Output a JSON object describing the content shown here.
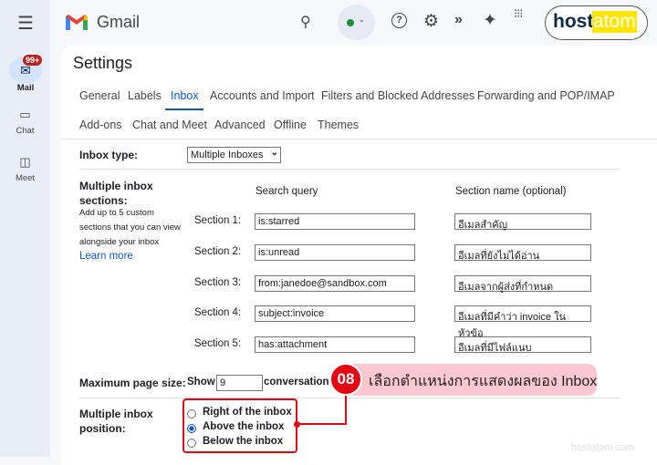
{
  "header": {
    "app_name": "Gmail",
    "brand": "host",
    "brand_highlight": "atom"
  },
  "rail": {
    "items": [
      {
        "label": "Mail",
        "badge": "99+"
      },
      {
        "label": "Chat"
      },
      {
        "label": "Meet"
      }
    ]
  },
  "settings": {
    "title": "Settings",
    "tabs_row1": [
      "General",
      "Labels",
      "Inbox",
      "Accounts and Import",
      "Filters and Blocked Addresses",
      "Forwarding and POP/IMAP"
    ],
    "tabs_row2": [
      "Add-ons",
      "Chat and Meet",
      "Advanced",
      "Offline",
      "Themes"
    ],
    "active_tab": "Inbox",
    "inbox_type": {
      "label": "Inbox type:",
      "value": "Multiple Inboxes"
    },
    "sections": {
      "title": "Multiple inbox sections:",
      "desc": [
        "Add up to 5 custom",
        "sections that you can view",
        "alongside your inbox"
      ],
      "learn_more": "Learn more",
      "col_query": "Search query",
      "col_name": "Section name (optional)",
      "rows": [
        {
          "label": "Section 1:",
          "query": "is:starred",
          "name": "อีเมลสำคัญ"
        },
        {
          "label": "Section 2:",
          "query": "is:unread",
          "name": "อีเมลที่ยังไม่ได้อ่าน"
        },
        {
          "label": "Section 3:",
          "query": "from:janedoe@sandbox.com",
          "name": "อีเมลจากผู้ส่งที่กำหนด"
        },
        {
          "label": "Section 4:",
          "query": "subject:invoice",
          "name": "อีเมลที่มีคำว่า invoice ในหัวข้อ"
        },
        {
          "label": "Section 5:",
          "query": "has:attachment",
          "name": "อีเมลที่มีไฟล์แนบ"
        }
      ]
    },
    "page_size": {
      "label": "Maximum page size:",
      "show": "Show",
      "value": "9",
      "suffix": "conversation"
    },
    "position": {
      "label1": "Multiple inbox",
      "label2": "position:",
      "options": [
        "Right of the inbox",
        "Above the inbox",
        "Below the inbox"
      ],
      "selected": "Above the inbox"
    }
  },
  "callout": {
    "step": "08",
    "text": "เลือกตำแหน่งการแสดงผลของ Inbox"
  },
  "watermark": "hostatom.com",
  "colors": {
    "accent": "#0b57d0",
    "callout_red": "#e30613",
    "callout_pink": "#fcc8cf"
  }
}
